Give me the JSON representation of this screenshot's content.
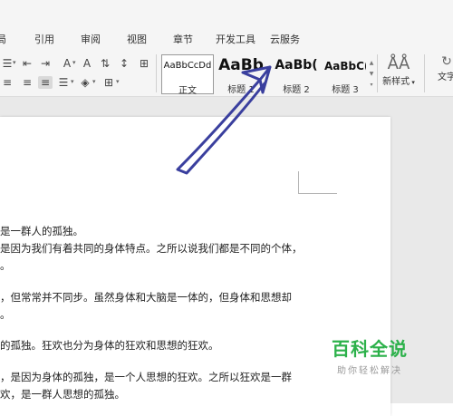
{
  "tabs": [
    {
      "label": "局"
    },
    {
      "label": "引用"
    },
    {
      "label": "审阅"
    },
    {
      "label": "视图"
    },
    {
      "label": "章节"
    },
    {
      "label": "开发工具"
    },
    {
      "label": "云服务"
    }
  ],
  "ribbon": {
    "icons": [
      "indent-decrease-icon",
      "indent-increase-icon",
      "text-direction-icon",
      "sort-icon",
      "show-marks-icon",
      "align-left-icon",
      "align-center-icon",
      "align-justify-icon",
      "line-spacing-icon",
      "shading-icon",
      "borders-icon"
    ],
    "styles": [
      {
        "preview": "AaBbCcDd",
        "name": "正文"
      },
      {
        "preview": "AaBb",
        "name": "标题 1"
      },
      {
        "preview": "AaBb(",
        "name": "标题 2"
      },
      {
        "preview": "AaBbC(",
        "name": "标题 3"
      }
    ],
    "new_style_label": "新样式",
    "text_tool_label": "文字"
  },
  "document": {
    "paragraphs": [
      "是一群人的孤独。",
      "是因为我们有着共同的身体特点。之所以说我们都是不同的个体，",
      "。",
      "，但常常并不同步。虽然身体和大脑是一体的，但身体和思想却",
      "。",
      "的孤独。狂欢也分为身体的狂欢和思想的狂欢。",
      "，是因为身体的孤独，是一个人思想的狂欢。之所以狂欢是一群",
      "欢，是一群人思想的孤独。"
    ]
  },
  "watermark": {
    "title": "百科全说",
    "subtitle": "助你轻松解决"
  },
  "colors": {
    "arrow": "#3a3f9e",
    "watermark_green": "#2cb14a"
  }
}
